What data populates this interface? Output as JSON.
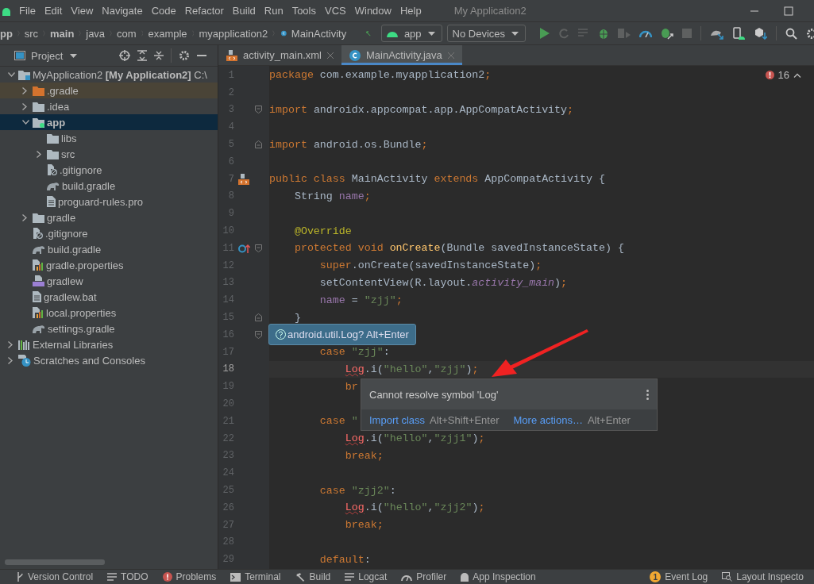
{
  "menu_bar": {
    "items": [
      "File",
      "Edit",
      "View",
      "Navigate",
      "Code",
      "Refactor",
      "Build",
      "Run",
      "Tools",
      "VCS",
      "Window",
      "Help"
    ],
    "title": "My Application2"
  },
  "breadcrumbs": [
    {
      "label": "pp",
      "bold": true,
      "kind": "module"
    },
    {
      "label": "src",
      "bold": false,
      "kind": "folder"
    },
    {
      "label": "main",
      "bold": true,
      "kind": "folder"
    },
    {
      "label": "java",
      "bold": false,
      "kind": "folder"
    },
    {
      "label": "com",
      "bold": false,
      "kind": "package"
    },
    {
      "label": "example",
      "bold": false,
      "kind": "package"
    },
    {
      "label": "myapplication2",
      "bold": false,
      "kind": "package"
    },
    {
      "label": "MainActivity",
      "bold": false,
      "kind": "class"
    }
  ],
  "run_config": {
    "module": "app",
    "device": "No Devices"
  },
  "project_panel": {
    "title": "Project",
    "tree": [
      {
        "label": "MyApplication2 **[My Application2]** C:\\",
        "kind": "module-root",
        "expanded": true,
        "selected": false,
        "children": [
          {
            "label": ".gradle",
            "kind": "folder-excluded",
            "expanded": false,
            "selected": false
          },
          {
            "label": ".idea",
            "kind": "folder",
            "expanded": false,
            "selected": false
          },
          {
            "label": "app",
            "kind": "folder-module",
            "expanded": true,
            "selected": true,
            "children": [
              {
                "label": "libs",
                "kind": "folder",
                "selected": false
              },
              {
                "label": "src",
                "kind": "folder",
                "expanded": false,
                "selected": false
              },
              {
                "label": ".gitignore",
                "kind": "ignore-file",
                "selected": false
              },
              {
                "label": "build.gradle",
                "kind": "gradle",
                "selected": false
              },
              {
                "label": "proguard-rules.pro",
                "kind": "text-file",
                "selected": false
              }
            ]
          },
          {
            "label": "gradle",
            "kind": "folder",
            "expanded": false,
            "selected": false
          },
          {
            "label": ".gitignore",
            "kind": "ignore-file",
            "selected": false
          },
          {
            "label": "build.gradle",
            "kind": "gradle",
            "selected": false
          },
          {
            "label": "gradle.properties",
            "kind": "properties",
            "selected": false
          },
          {
            "label": "gradlew",
            "kind": "script",
            "selected": false
          },
          {
            "label": "gradlew.bat",
            "kind": "text-file",
            "selected": false
          },
          {
            "label": "local.properties",
            "kind": "properties",
            "selected": false
          },
          {
            "label": "settings.gradle",
            "kind": "gradle",
            "selected": false
          }
        ]
      },
      {
        "label": "External Libraries",
        "kind": "libraries",
        "expanded": false,
        "selected": false
      },
      {
        "label": "Scratches and Consoles",
        "kind": "scratches",
        "expanded": false,
        "selected": false
      }
    ]
  },
  "editor_tabs": [
    {
      "label": "activity_main.xml",
      "kind": "xml",
      "selected": false
    },
    {
      "label": "MainActivity.java",
      "kind": "class",
      "selected": true
    }
  ],
  "error_count": "16",
  "code_lines": [
    {
      "number": "1",
      "current": false,
      "tokens": [
        {
          "kind": "keyword",
          "text": "package"
        },
        {
          "kind": "plain",
          "text": " com.example.myapplication2"
        },
        {
          "kind": "keyword",
          "text": ";"
        }
      ]
    },
    {
      "number": "2",
      "current": false
    },
    {
      "number": "3",
      "current": false,
      "fold_marker": {
        "kind": "start"
      },
      "tokens": [
        {
          "kind": "keyword",
          "text": "import"
        },
        {
          "kind": "plain",
          "text": " androidx.appcompat.app.AppCompatActivity"
        },
        {
          "kind": "keyword",
          "text": ";"
        }
      ]
    },
    {
      "number": "4",
      "current": false
    },
    {
      "number": "5",
      "current": false,
      "fold_marker": {
        "kind": "end"
      },
      "tokens": [
        {
          "kind": "keyword",
          "text": "import"
        },
        {
          "kind": "plain",
          "text": " android.os.Bundle"
        },
        {
          "kind": "keyword",
          "text": ";"
        }
      ]
    },
    {
      "number": "6",
      "current": false
    },
    {
      "number": "7",
      "current": false,
      "gutter_icon": {
        "kind": "layout"
      },
      "tokens": [
        {
          "kind": "keyword",
          "text": "public class "
        },
        {
          "kind": "plain",
          "text": "MainActivity "
        },
        {
          "kind": "keyword",
          "text": "extends "
        },
        {
          "kind": "plain",
          "text": "AppCompatActivity {"
        }
      ]
    },
    {
      "number": "8",
      "current": false,
      "tokens": [
        {
          "kind": "plain",
          "text": "    String "
        },
        {
          "kind": "field",
          "text": "name"
        },
        {
          "kind": "keyword",
          "text": ";"
        }
      ]
    },
    {
      "number": "9",
      "current": false
    },
    {
      "number": "10",
      "current": false,
      "tokens": [
        {
          "kind": "annotation",
          "text": "    @Override"
        }
      ]
    },
    {
      "number": "11",
      "current": false,
      "gutter_icon": {
        "kind": "override"
      },
      "fold_marker": {
        "kind": "start"
      },
      "tokens": [
        {
          "kind": "keyword",
          "text": "    protected void "
        },
        {
          "kind": "method",
          "text": "onCreate"
        },
        {
          "kind": "plain",
          "text": "(Bundle savedInstanceState) {"
        }
      ]
    },
    {
      "number": "12",
      "current": false,
      "tokens": [
        {
          "kind": "keyword",
          "text": "        super"
        },
        {
          "kind": "plain",
          "text": ".onCreate(savedInstanceState)"
        },
        {
          "kind": "keyword",
          "text": ";"
        }
      ]
    },
    {
      "number": "13",
      "current": false,
      "tokens": [
        {
          "kind": "plain",
          "text": "        setContentView(R.layout."
        },
        {
          "kind": "constant",
          "text": "activity_main"
        },
        {
          "kind": "plain",
          "text": ")"
        },
        {
          "kind": "keyword",
          "text": ";"
        }
      ]
    },
    {
      "number": "14",
      "current": false,
      "tokens": [
        {
          "kind": "field",
          "text": "        name"
        },
        {
          "kind": "plain",
          "text": " = "
        },
        {
          "kind": "string",
          "text": "\"zjj\""
        },
        {
          "kind": "keyword",
          "text": ";"
        }
      ]
    },
    {
      "number": "15",
      "current": false,
      "fold_marker": {
        "kind": "end"
      },
      "tokens": [
        {
          "kind": "plain",
          "text": "    }"
        }
      ]
    },
    {
      "number": "16",
      "current": false,
      "fold_marker": {
        "kind": "start"
      }
    },
    {
      "number": "17",
      "current": false,
      "tokens": [
        {
          "kind": "keyword",
          "text": "        case "
        },
        {
          "kind": "string",
          "text": "\"zjj\""
        },
        {
          "kind": "plain",
          "text": ":"
        }
      ]
    },
    {
      "number": "18",
      "current": true,
      "tokens": [
        {
          "kind": "error",
          "text": "            Log"
        },
        {
          "kind": "plain",
          "text": ".i("
        },
        {
          "kind": "string",
          "text": "\"hello\""
        },
        {
          "kind": "plain",
          "text": ","
        },
        {
          "kind": "string",
          "text": "\"zjj\""
        },
        {
          "kind": "plain",
          "text": ")"
        },
        {
          "kind": "keyword",
          "text": ";"
        }
      ]
    },
    {
      "number": "19",
      "current": false,
      "tokens": [
        {
          "kind": "keyword",
          "text": "            br"
        }
      ]
    },
    {
      "number": "20",
      "current": false
    },
    {
      "number": "21",
      "current": false,
      "tokens": [
        {
          "kind": "keyword",
          "text": "        case "
        },
        {
          "kind": "string",
          "text": "\""
        }
      ]
    },
    {
      "number": "22",
      "current": false,
      "tokens": [
        {
          "kind": "error",
          "text": "            Log"
        },
        {
          "kind": "plain",
          "text": ".i("
        },
        {
          "kind": "string",
          "text": "\"hello\""
        },
        {
          "kind": "plain",
          "text": ","
        },
        {
          "kind": "string",
          "text": "\"zjj1\""
        },
        {
          "kind": "plain",
          "text": ")"
        },
        {
          "kind": "keyword",
          "text": ";"
        }
      ]
    },
    {
      "number": "23",
      "current": false,
      "tokens": [
        {
          "kind": "keyword",
          "text": "            break;"
        }
      ]
    },
    {
      "number": "24",
      "current": false
    },
    {
      "number": "25",
      "current": false,
      "tokens": [
        {
          "kind": "keyword",
          "text": "        case "
        },
        {
          "kind": "string",
          "text": "\"zjj2\""
        },
        {
          "kind": "plain",
          "text": ":"
        }
      ]
    },
    {
      "number": "26",
      "current": false,
      "tokens": [
        {
          "kind": "error",
          "text": "            Log"
        },
        {
          "kind": "plain",
          "text": ".i("
        },
        {
          "kind": "string",
          "text": "\"hello\""
        },
        {
          "kind": "plain",
          "text": ","
        },
        {
          "kind": "string",
          "text": "\"zjj2\""
        },
        {
          "kind": "plain",
          "text": ")"
        },
        {
          "kind": "keyword",
          "text": ";"
        }
      ]
    },
    {
      "number": "27",
      "current": false,
      "tokens": [
        {
          "kind": "keyword",
          "text": "            break;"
        }
      ]
    },
    {
      "number": "28",
      "current": false
    },
    {
      "number": "29",
      "current": false,
      "tokens": [
        {
          "kind": "keyword",
          "text": "        default"
        },
        {
          "kind": "plain",
          "text": ":"
        }
      ]
    }
  ],
  "intention_tooltip": {
    "text": "android.util.Log? Alt+Enter"
  },
  "problem_popup": {
    "message": "Cannot resolve symbol 'Log'",
    "actions": [
      {
        "label": "Import class",
        "shortcut": "Alt+Shift+Enter"
      },
      {
        "label": "More actions…",
        "shortcut": "Alt+Enter"
      }
    ]
  },
  "bottom_tools_left": [
    {
      "label": "Version Control",
      "kind": "vcs"
    },
    {
      "label": "TODO",
      "kind": "list"
    },
    {
      "label": "Problems",
      "kind": "problems"
    },
    {
      "label": "Terminal",
      "kind": "terminal"
    },
    {
      "label": "Build",
      "kind": "hammer"
    },
    {
      "label": "Logcat",
      "kind": "list"
    },
    {
      "label": "Profiler",
      "kind": "gauge"
    },
    {
      "label": "App Inspection",
      "kind": "inspect"
    }
  ],
  "bottom_tools_right": [
    {
      "label": "Event Log",
      "kind": "badge",
      "badge": "1"
    },
    {
      "label": "Layout Inspecto",
      "kind": "layout"
    }
  ]
}
